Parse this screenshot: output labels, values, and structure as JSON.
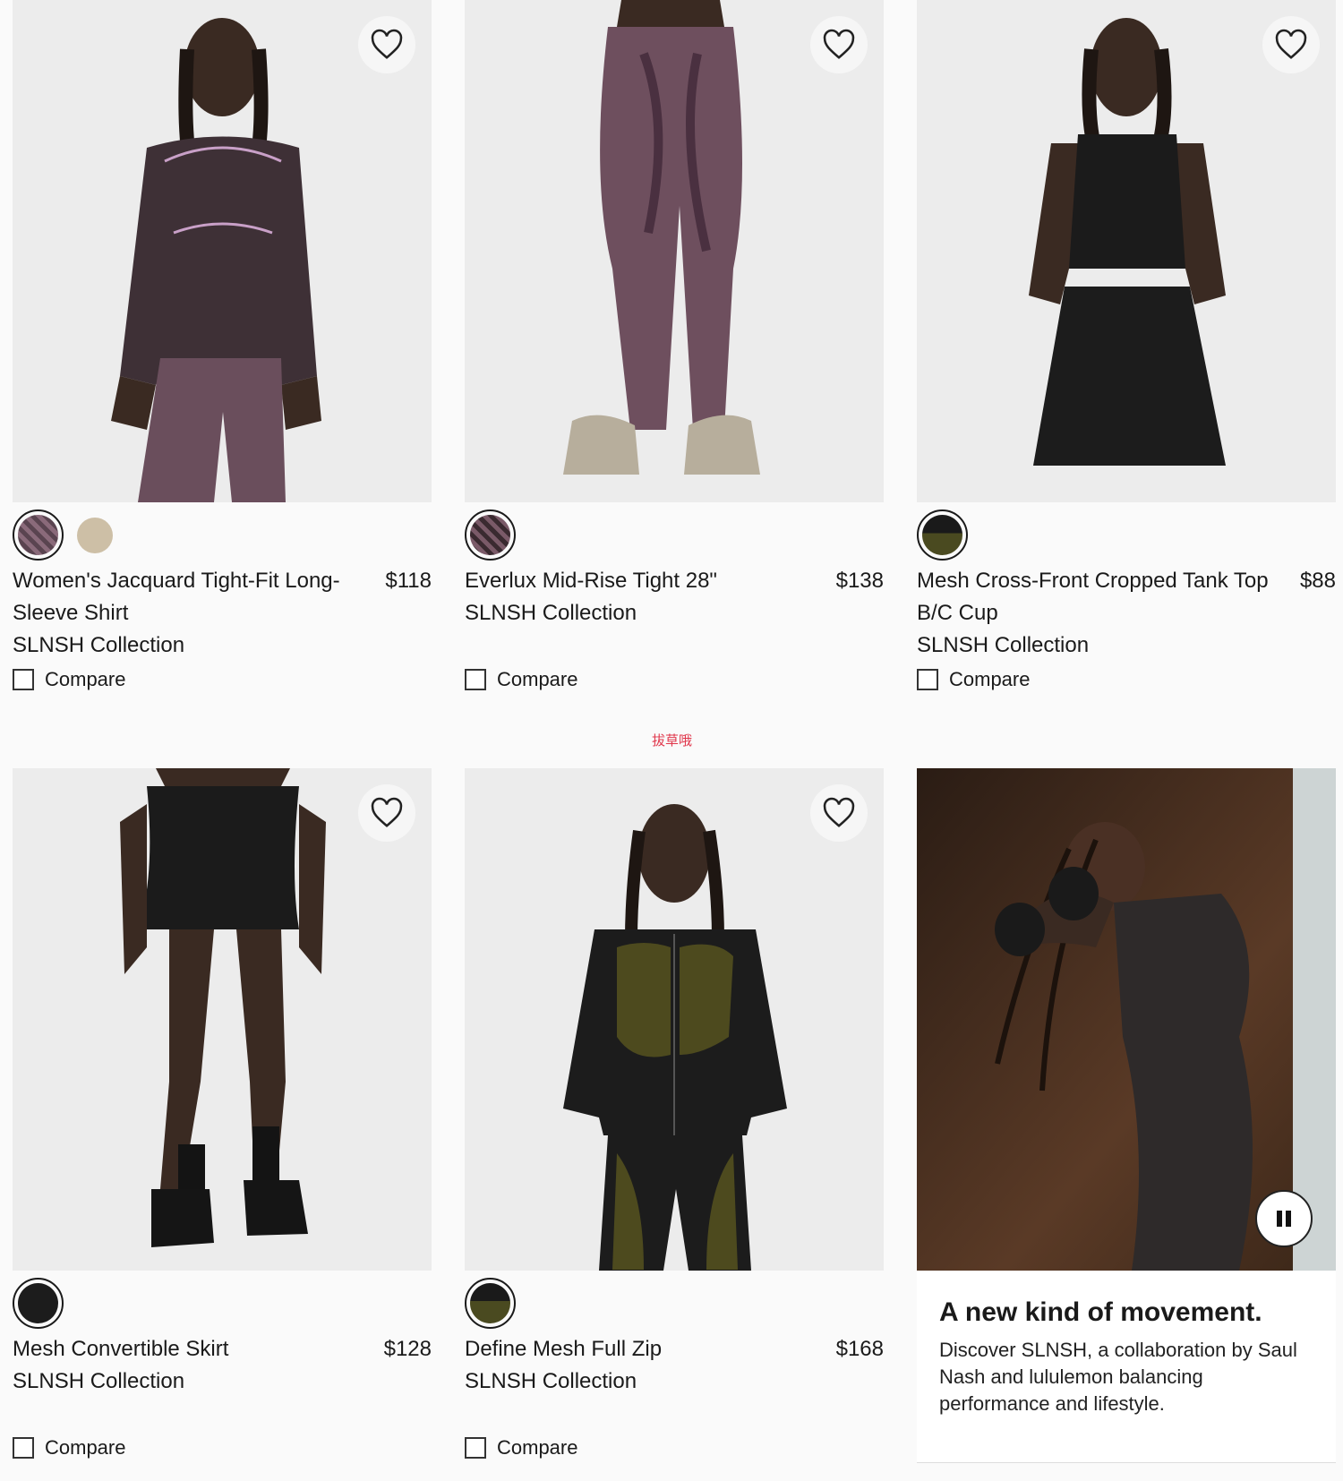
{
  "products": [
    {
      "name": "Women's Jacquard Tight-Fit Long-Sleeve Shirt",
      "price": "$118",
      "collection": "SLNSH Collection",
      "compare_label": "Compare",
      "swatches": [
        {
          "color": "#5a4450",
          "selected": true
        },
        {
          "color": "#cdbfa6",
          "selected": false
        }
      ]
    },
    {
      "name": "Everlux Mid-Rise Tight 28\"",
      "price": "$138",
      "collection": "SLNSH Collection",
      "compare_label": "Compare",
      "swatches": [
        {
          "color": "#7a5a68",
          "selected": true
        }
      ]
    },
    {
      "name": "Mesh Cross-Front Cropped Tank Top B/C Cup",
      "price": "$88",
      "collection": "SLNSH Collection",
      "compare_label": "Compare",
      "swatches": [
        {
          "color": "#2a2a1a",
          "accent": "#4a4a20",
          "selected": true
        }
      ]
    },
    {
      "name": "Mesh Convertible Skirt",
      "price": "$128",
      "collection": "SLNSH Collection",
      "compare_label": "Compare",
      "swatches": [
        {
          "color": "#1c1c1c",
          "selected": true
        }
      ]
    },
    {
      "name": "Define Mesh Full Zip",
      "price": "$168",
      "collection": "SLNSH Collection",
      "compare_label": "Compare",
      "swatches": [
        {
          "color": "#1c1c1c",
          "accent": "#4a4a20",
          "selected": true
        }
      ]
    }
  ],
  "promo": {
    "title": "A new kind of movement.",
    "description": "Discover SLNSH, a collaboration by Saul Nash and lululemon balancing performance and lifestyle."
  },
  "watermark": "拔草哦",
  "icons": {
    "wishlist": "heart-outline-icon",
    "pause": "pause-icon"
  }
}
